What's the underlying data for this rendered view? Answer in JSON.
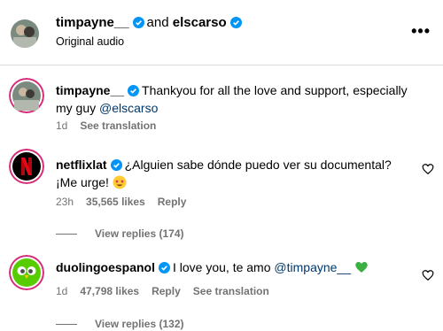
{
  "header": {
    "user1": "timpayne__",
    "joiner": "and",
    "user2": "elscarso",
    "subtitle": "Original audio",
    "more_icon": "more-horizontal-icon"
  },
  "comments": [
    {
      "username": "timpayne__",
      "text": "Thankyou for all the love and support, especially my guy",
      "mention": "@elscarso",
      "time": "1d",
      "likes": "",
      "see_translation": "See translation"
    },
    {
      "username": "netflixlat",
      "text": "¿Alguien sabe dónde puedo ver su documental? ¡Me urge!",
      "time": "23h",
      "likes": "35,565 likes",
      "reply": "Reply",
      "view_replies": "View replies (174)"
    },
    {
      "username": "duolingoespanol",
      "text": "I love you, te amo",
      "mention": "@timpayne__",
      "time": "1d",
      "likes": "47,798 likes",
      "reply": "Reply",
      "see_translation": "See translation",
      "view_replies": "View replies (132)"
    }
  ],
  "colors": {
    "verified": "#0095f6",
    "mention": "#00376b",
    "meta": "#737373",
    "netflix": "#e50914",
    "duolingo": "#58cc02"
  }
}
